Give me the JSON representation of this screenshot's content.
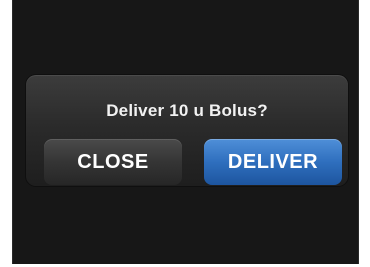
{
  "dialog": {
    "prompt": "Deliver 10 u Bolus?",
    "close_label": "CLOSE",
    "deliver_label": "DELIVER"
  },
  "colors": {
    "screen_background": "#171717",
    "dialog_background": "#2b2b2b",
    "close_button": "#353535",
    "deliver_button": "#2f6fbe",
    "text": "#ffffff"
  }
}
